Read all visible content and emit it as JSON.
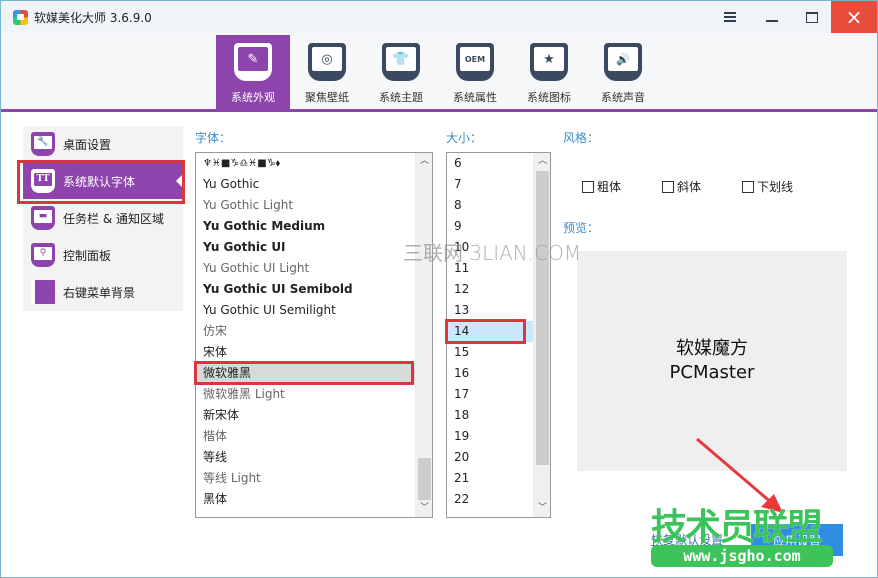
{
  "window": {
    "title": "软媒美化大师 3.6.9.0",
    "controls": {
      "menu": "menu-icon",
      "minimize": "minimize-icon",
      "maximize": "maximize-icon",
      "close": "×"
    }
  },
  "top_tabs": [
    {
      "label": "系统外观",
      "icon": "paintbrush-icon",
      "glyph": "✎",
      "active": true
    },
    {
      "label": "聚焦壁纸",
      "icon": "target-icon",
      "glyph": "◎",
      "active": false
    },
    {
      "label": "系统主题",
      "icon": "tshirt-icon",
      "glyph": "👕",
      "active": false
    },
    {
      "label": "系统属性",
      "icon": "oem-icon",
      "glyph": "OEM",
      "active": false
    },
    {
      "label": "系统图标",
      "icon": "star-icon",
      "glyph": "★",
      "active": false
    },
    {
      "label": "系统声音",
      "icon": "speaker-icon",
      "glyph": "🔊",
      "active": false
    }
  ],
  "sidebar": {
    "items": [
      {
        "label": "桌面设置",
        "icon": "wrench-icon",
        "glyph": "🔧",
        "active": false
      },
      {
        "label": "系统默认字体",
        "icon": "font-icon",
        "glyph": "TT",
        "active": true
      },
      {
        "label": "任务栏 & 通知区域",
        "icon": "taskbar-icon",
        "glyph": "▬",
        "active": false
      },
      {
        "label": "控制面板",
        "icon": "magnifier-icon",
        "glyph": "⚲",
        "active": false
      },
      {
        "label": "右键菜单背景",
        "icon": "context-menu-icon",
        "glyph": "",
        "active": false
      }
    ]
  },
  "font_panel": {
    "label": "字体：",
    "items": [
      "♆♓■♑♎♓■♑⬧",
      "Yu Gothic",
      "Yu Gothic Light",
      "Yu Gothic Medium",
      "Yu Gothic UI",
      "Yu Gothic UI Light",
      "Yu Gothic UI Semibold",
      "Yu Gothic UI Semilight",
      "仿宋",
      "宋体",
      "微软雅黑",
      "微软雅黑 Light",
      "新宋体",
      "楷体",
      "等线",
      "等线 Light",
      "黑体"
    ],
    "selected": "微软雅黑"
  },
  "size_panel": {
    "label": "大小：",
    "items": [
      "6",
      "7",
      "8",
      "9",
      "10",
      "11",
      "12",
      "13",
      "14",
      "15",
      "16",
      "17",
      "18",
      "19",
      "20",
      "21",
      "22"
    ],
    "selected": "14"
  },
  "style_panel": {
    "label": "风格：",
    "options": [
      {
        "label": "粗体",
        "checked": false
      },
      {
        "label": "斜体",
        "checked": false
      },
      {
        "label": "下划线",
        "checked": false
      }
    ]
  },
  "preview_panel": {
    "label": "预览：",
    "line1": "软媒魔方",
    "line2": "PCMaster"
  },
  "actions": {
    "reset_label": "恢复默认设置",
    "apply_label": "应用设置"
  },
  "overlays": {
    "watermark_3lian": "三联网 3LIAN.COM",
    "watermark_jsgho_title": "技术员联盟",
    "watermark_jsgho_url": "www.jsgho.com",
    "highlight_color": "#d9363e",
    "arrow_color": "#e8393a"
  },
  "colors": {
    "accent": "#8e44ad",
    "label_blue": "#3a8fc7",
    "close_red": "#e74c3c",
    "apply_blue": "#2f8ee0"
  }
}
